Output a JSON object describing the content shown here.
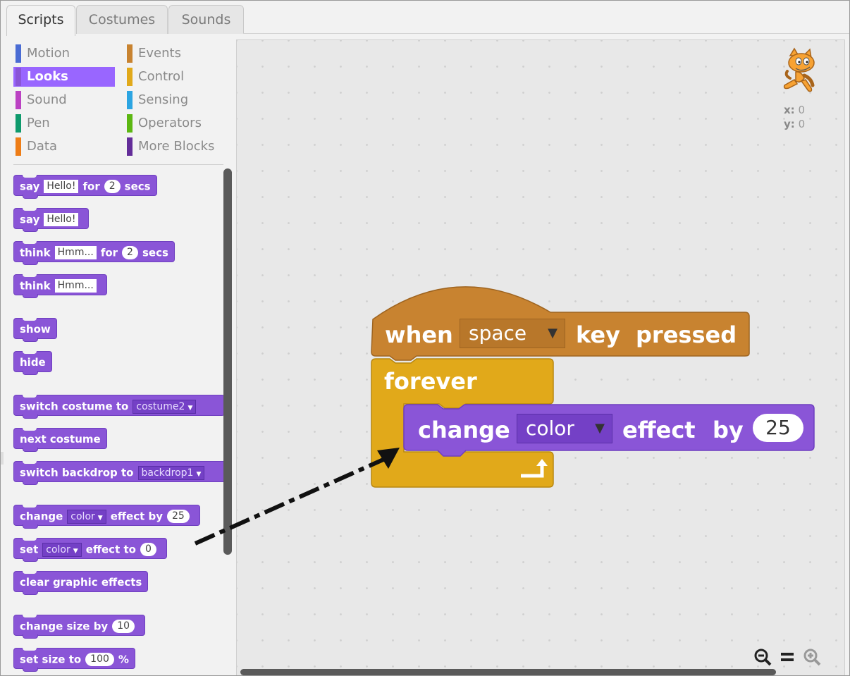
{
  "tabs": [
    {
      "label": "Scripts",
      "active": true
    },
    {
      "label": "Costumes",
      "active": false
    },
    {
      "label": "Sounds",
      "active": false
    }
  ],
  "categories": [
    {
      "label": "Motion",
      "color": "#4a6cd4"
    },
    {
      "label": "Events",
      "color": "#c88330"
    },
    {
      "label": "Looks",
      "color": "#8a55d7",
      "selected": true
    },
    {
      "label": "Control",
      "color": "#e1a91a"
    },
    {
      "label": "Sound",
      "color": "#bb42c3"
    },
    {
      "label": "Sensing",
      "color": "#2ca5e2"
    },
    {
      "label": "Pen",
      "color": "#0e9a6c"
    },
    {
      "label": "Operators",
      "color": "#5cb712"
    },
    {
      "label": "Data",
      "color": "#ee7d16"
    },
    {
      "label": "More Blocks",
      "color": "#632d99"
    }
  ],
  "palette": {
    "say_for": {
      "w1": "say",
      "v1": "Hello!",
      "w2": "for",
      "v2": "2",
      "w3": "secs"
    },
    "say": {
      "w1": "say",
      "v1": "Hello!"
    },
    "think_for": {
      "w1": "think",
      "v1": "Hmm...",
      "w2": "for",
      "v2": "2",
      "w3": "secs"
    },
    "think": {
      "w1": "think",
      "v1": "Hmm..."
    },
    "show": "show",
    "hide": "hide",
    "switch_costume": {
      "w1": "switch costume to",
      "v1": "costume2"
    },
    "next_costume": "next costume",
    "switch_backdrop": {
      "w1": "switch backdrop to",
      "v1": "backdrop1"
    },
    "change_effect": {
      "w1": "change",
      "v1": "color",
      "w2": "effect by",
      "v2": "25"
    },
    "set_effect": {
      "w1": "set",
      "v1": "color",
      "w2": "effect to",
      "v2": "0"
    },
    "clear_effects": "clear graphic effects",
    "change_size": {
      "w1": "change size by",
      "v1": "10"
    },
    "set_size": {
      "w1": "set size to",
      "v1": "100",
      "w2": "%"
    }
  },
  "sprite": {
    "x_label": "x:",
    "x": "0",
    "y_label": "y:",
    "y": "0"
  },
  "script": {
    "hat": {
      "w1": "when",
      "key": "space",
      "w2": "key",
      "w3": "pressed",
      "color": "#c88330"
    },
    "forever": {
      "label": "forever",
      "color": "#e1a91a"
    },
    "inner": {
      "w1": "change",
      "effect": "color",
      "w2": "effect",
      "w3": "by",
      "value": "25",
      "color": "#8a55d7"
    }
  },
  "zoom": {
    "out_icon": "zoom-out-icon",
    "reset_icon": "zoom-reset-icon",
    "in_icon": "zoom-in-icon"
  }
}
